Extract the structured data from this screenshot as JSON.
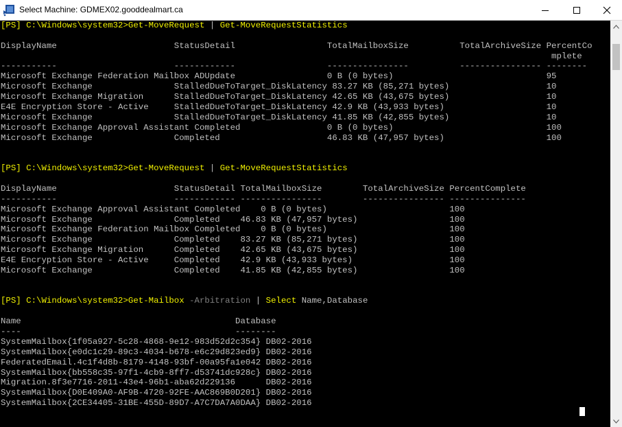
{
  "window": {
    "title": "Select Machine: GDMEX02.gooddealmart.ca",
    "minimize_label": "minimize",
    "maximize_label": "maximize",
    "close_label": "close"
  },
  "colors": {
    "console_bg": "#000000",
    "text": "#c0c0c0",
    "prompt_command": "#f0f000",
    "parameter": "#808080"
  },
  "console": {
    "lines": [
      [
        {
          "t": "[PS] C:\\Windows\\system32>",
          "c": "y"
        },
        {
          "t": "Get-MoveRequest",
          "c": "y"
        },
        {
          "t": " | ",
          "c": "n"
        },
        {
          "t": "Get-MoveRequestStatistics",
          "c": "y"
        }
      ],
      [],
      [
        {
          "t": "DisplayName                       StatusDetail                  TotalMailboxSize          TotalArchiveSize PercentCo",
          "c": "n"
        }
      ],
      [
        {
          "t": "                                                                                                            mplete",
          "c": "n"
        }
      ],
      [
        {
          "t": "-----------                       ------------                  ----------------          ---------------- --------",
          "c": "n"
        }
      ],
      [
        {
          "t": "Microsoft Exchange Federation Mailbox ADUpdate                  0 B (0 bytes)                              95",
          "c": "n"
        }
      ],
      [
        {
          "t": "Microsoft Exchange                StalledDueToTarget_DiskLatency 83.27 KB (85,271 bytes)                   10",
          "c": "n"
        }
      ],
      [
        {
          "t": "Microsoft Exchange Migration      StalledDueToTarget_DiskLatency 42.65 KB (43,675 bytes)                   10",
          "c": "n"
        }
      ],
      [
        {
          "t": "E4E Encryption Store - Active     StalledDueToTarget_DiskLatency 42.9 KB (43,933 bytes)                    10",
          "c": "n"
        }
      ],
      [
        {
          "t": "Microsoft Exchange                StalledDueToTarget_DiskLatency 41.85 KB (42,855 bytes)                   10",
          "c": "n"
        }
      ],
      [
        {
          "t": "Microsoft Exchange Approval Assistant Completed                 0 B (0 bytes)                              100",
          "c": "n"
        }
      ],
      [
        {
          "t": "Microsoft Exchange                Completed                     46.83 KB (47,957 bytes)                    100",
          "c": "n"
        }
      ],
      [],
      [],
      [
        {
          "t": "[PS] C:\\Windows\\system32>",
          "c": "y"
        },
        {
          "t": "Get-MoveRequest",
          "c": "y"
        },
        {
          "t": " | ",
          "c": "n"
        },
        {
          "t": "Get-MoveRequestStatistics",
          "c": "y"
        }
      ],
      [],
      [
        {
          "t": "DisplayName                       StatusDetail TotalMailboxSize        TotalArchiveSize PercentComplete",
          "c": "n"
        }
      ],
      [
        {
          "t": "-----------                       ------------ ----------------        ---------------- ---------------",
          "c": "n"
        }
      ],
      [
        {
          "t": "Microsoft Exchange Approval Assistant Completed    0 B (0 bytes)                        100",
          "c": "n"
        }
      ],
      [
        {
          "t": "Microsoft Exchange                Completed    46.83 KB (47,957 bytes)                  100",
          "c": "n"
        }
      ],
      [
        {
          "t": "Microsoft Exchange Federation Mailbox Completed    0 B (0 bytes)                        100",
          "c": "n"
        }
      ],
      [
        {
          "t": "Microsoft Exchange                Completed    83.27 KB (85,271 bytes)                  100",
          "c": "n"
        }
      ],
      [
        {
          "t": "Microsoft Exchange Migration      Completed    42.65 KB (43,675 bytes)                  100",
          "c": "n"
        }
      ],
      [
        {
          "t": "E4E Encryption Store - Active     Completed    42.9 KB (43,933 bytes)                   100",
          "c": "n"
        }
      ],
      [
        {
          "t": "Microsoft Exchange                Completed    41.85 KB (42,855 bytes)                  100",
          "c": "n"
        }
      ],
      [],
      [],
      [
        {
          "t": "[PS] C:\\Windows\\system32>",
          "c": "y"
        },
        {
          "t": "Get-Mailbox",
          "c": "y"
        },
        {
          "t": " -Arbitration",
          "c": "g"
        },
        {
          "t": " | ",
          "c": "n"
        },
        {
          "t": "Select",
          "c": "y"
        },
        {
          "t": " Name,Database",
          "c": "n"
        }
      ],
      [],
      [
        {
          "t": "Name                                          Database",
          "c": "n"
        }
      ],
      [
        {
          "t": "----                                          --------",
          "c": "n"
        }
      ],
      [
        {
          "t": "SystemMailbox{1f05a927-5c28-4868-9e12-983d52d2c354} DB02-2016",
          "c": "n"
        }
      ],
      [
        {
          "t": "SystemMailbox{e0dc1c29-89c3-4034-b678-e6c29d823ed9} DB02-2016",
          "c": "n"
        }
      ],
      [
        {
          "t": "FederatedEmail.4c1f4d8b-8179-4148-93bf-00a95fa1e042 DB02-2016",
          "c": "n"
        }
      ],
      [
        {
          "t": "SystemMailbox{bb558c35-97f1-4cb9-8ff7-d53741dc928c} DB02-2016",
          "c": "n"
        }
      ],
      [
        {
          "t": "Migration.8f3e7716-2011-43e4-96b1-aba62d229136      DB02-2016",
          "c": "n"
        }
      ],
      [
        {
          "t": "SystemMailbox{D0E409A0-AF9B-4720-92FE-AAC869B0D201} DB02-2016",
          "c": "n"
        }
      ],
      [
        {
          "t": "SystemMailbox{2CE34405-31BE-455D-89D7-A7C7DA7A0DAA} DB02-2016",
          "c": "n"
        }
      ]
    ]
  }
}
